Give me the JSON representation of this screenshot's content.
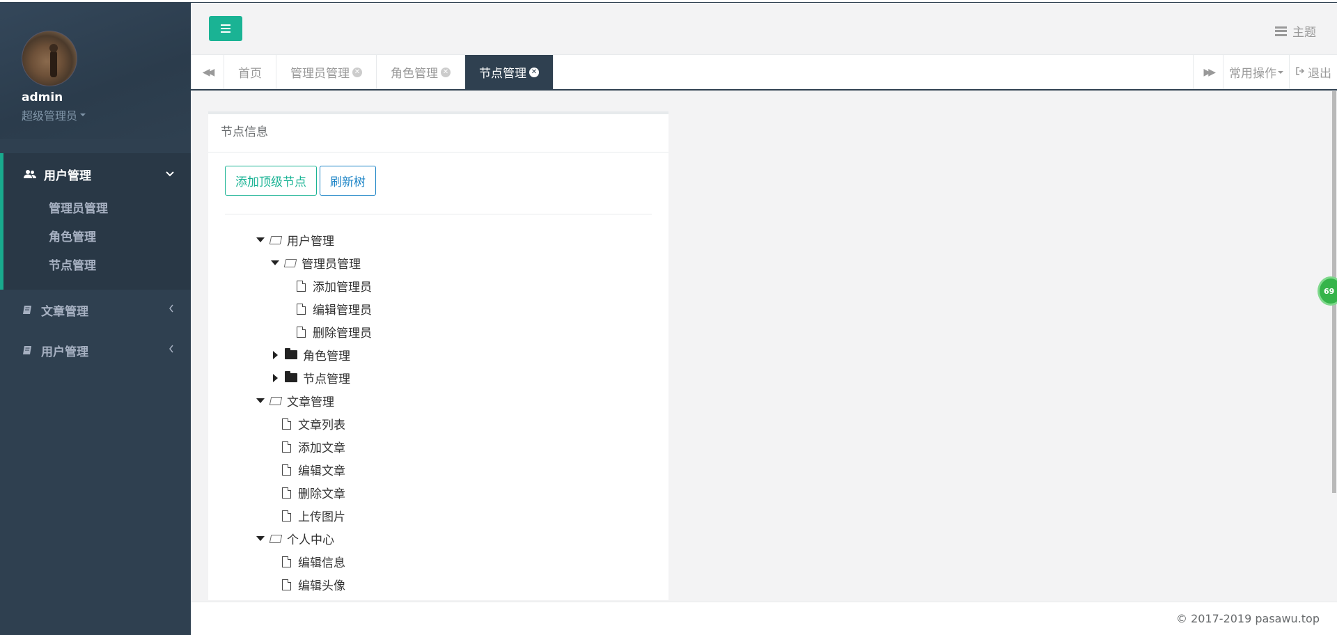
{
  "sidebar": {
    "user_name": "admin",
    "user_role": "超级管理员",
    "groups": [
      {
        "label": "用户管理",
        "icon": "users-icon",
        "expanded": true,
        "items": [
          "管理员管理",
          "角色管理",
          "节点管理"
        ]
      },
      {
        "label": "文章管理",
        "icon": "book-icon",
        "expanded": false
      },
      {
        "label": "用户管理",
        "icon": "book-icon",
        "expanded": false
      }
    ]
  },
  "header": {
    "menu_icon": "hamburger-icon",
    "theme_label": "主题"
  },
  "tabs": {
    "items": [
      {
        "label": "首页",
        "closable": false
      },
      {
        "label": "管理员管理",
        "closable": true
      },
      {
        "label": "角色管理",
        "closable": true
      },
      {
        "label": "节点管理",
        "closable": true,
        "active": true
      }
    ],
    "common_ops": "常用操作",
    "logout": "退出"
  },
  "panel": {
    "title": "节点信息",
    "add_top_node": "添加顶级节点",
    "refresh_tree": "刷新树"
  },
  "tree": [
    {
      "label": "用户管理",
      "level": 0,
      "type": "open"
    },
    {
      "label": "管理员管理",
      "level": 1,
      "type": "open"
    },
    {
      "label": "添加管理员",
      "level": 2,
      "type": "file"
    },
    {
      "label": "编辑管理员",
      "level": 2,
      "type": "file"
    },
    {
      "label": "删除管理员",
      "level": 2,
      "type": "file"
    },
    {
      "label": "角色管理",
      "level": 1,
      "type": "closed"
    },
    {
      "label": "节点管理",
      "level": 1,
      "type": "closed"
    },
    {
      "label": "文章管理",
      "level": 0,
      "type": "open"
    },
    {
      "label": "文章列表",
      "level": 1,
      "type": "file"
    },
    {
      "label": "添加文章",
      "level": 1,
      "type": "file"
    },
    {
      "label": "编辑文章",
      "level": 1,
      "type": "file"
    },
    {
      "label": "删除文章",
      "level": 1,
      "type": "file"
    },
    {
      "label": "上传图片",
      "level": 1,
      "type": "file"
    },
    {
      "label": "个人中心",
      "level": 0,
      "type": "open"
    },
    {
      "label": "编辑信息",
      "level": 1,
      "type": "file"
    },
    {
      "label": "编辑头像",
      "level": 1,
      "type": "file"
    }
  ],
  "float_badge": "69",
  "footer": "© 2017-2019 pasawu.top",
  "colors": {
    "sidebar": "#2f4050",
    "accent": "#1ab394",
    "blue": "#1c84c6"
  }
}
